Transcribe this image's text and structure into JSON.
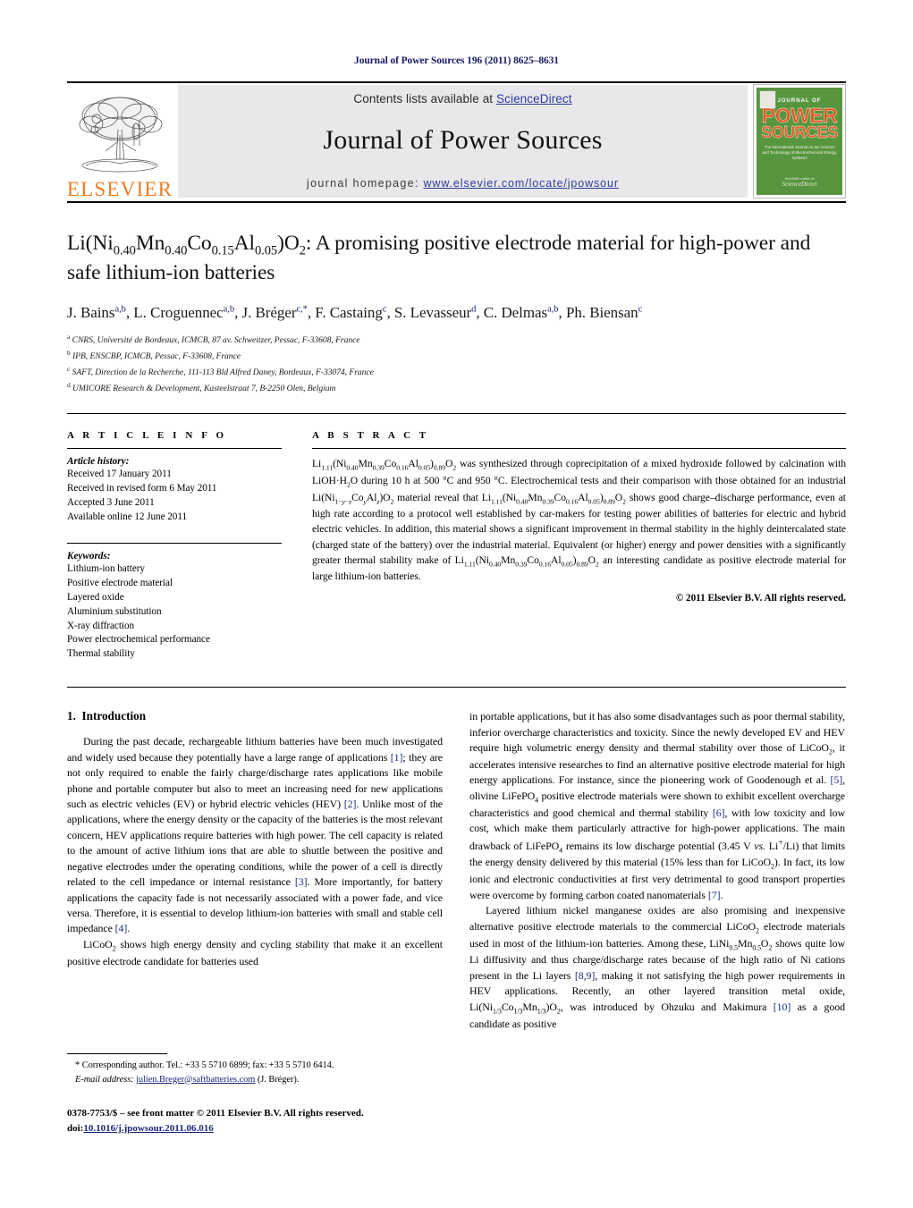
{
  "running_head": "Journal of Power Sources 196 (2011) 8625–8631",
  "masthead": {
    "publisher_name": "ELSEVIER",
    "contents_prefix": "Contents lists available at ",
    "sciencedirect": "ScienceDirect",
    "journal_title": "Journal of Power Sources",
    "homepage_prefix": "journal homepage: ",
    "homepage_url": "www.elsevier.com/locate/jpowsour",
    "cover": {
      "line1": "JOURNAL OF",
      "line2": "POWER",
      "line3": "SOURCES",
      "subtitle": "The International Journal on the Science and Technology of Electrochemical Energy Systems",
      "foot_small": "Available online at",
      "foot_big": "ScienceDirect"
    },
    "colors": {
      "link": "#2c3b9e",
      "elsevier_orange": "#ef7d22",
      "cover_green": "#57953f",
      "cover_orange": "#e2561f",
      "band_gray": "#e8e8ea"
    }
  },
  "title": {
    "part1": "Li(Ni",
    "sub1": "0.40",
    "part2": "Mn",
    "sub2": "0.40",
    "part3": "Co",
    "sub3": "0.15",
    "part4": "Al",
    "sub4": "0.05",
    "part5": ")O",
    "sub5": "2",
    "part6": ": A promising positive electrode material for high-power and safe lithium-ion batteries",
    "full": "Li(Ni0.40Mn0.40Co0.15Al0.05)O2: A promising positive electrode material for high-power and safe lithium-ion batteries"
  },
  "authors": [
    {
      "name": "J. Bains",
      "sup": "a,b"
    },
    {
      "name": "L. Croguennec",
      "sup": "a,b"
    },
    {
      "name": "J. Bréger",
      "sup": "c,*"
    },
    {
      "name": "F. Castaing",
      "sup": "c"
    },
    {
      "name": "S. Levasseur",
      "sup": "d"
    },
    {
      "name": "C. Delmas",
      "sup": "a,b"
    },
    {
      "name": "Ph. Biensan",
      "sup": "c"
    }
  ],
  "affiliations": [
    {
      "mark": "a",
      "text": "CNRS, Université de Bordeaux, ICMCB, 87 av. Schweitzer, Pessac, F-33608, France"
    },
    {
      "mark": "b",
      "text": "IPB, ENSCBP, ICMCB, Pessac, F-33608, France"
    },
    {
      "mark": "c",
      "text": "SAFT, Direction de la Recherche, 111-113 Bld Alfred Daney, Bordeaux, F-33074, France"
    },
    {
      "mark": "d",
      "text": "UMICORE Research & Development, Kasteelstraat 7, B-2250 Olen, Belgium"
    }
  ],
  "article_info": {
    "heading": "A R T I C L E    I N F O",
    "history_label": "Article history:",
    "history": [
      "Received 17 January 2011",
      "Received in revised form 6 May 2011",
      "Accepted 3 June 2011",
      "Available online 12 June 2011"
    ],
    "keywords_label": "Keywords:",
    "keywords": [
      "Lithium-ion battery",
      "Positive electrode material",
      "Layered oxide",
      "Aluminium substitution",
      "X-ray diffraction",
      "Power electrochemical performance",
      "Thermal stability"
    ]
  },
  "abstract": {
    "heading": "A B S T R A C T",
    "text": "was synthesized through coprecipitation of a mixed hydroxide followed by calcination with LiOH·H2O during 10 h at 500 °C and 950 °C. Electrochemical tests and their comparison with those obtained for an industrial Li(Ni1−y−zCoyAlz)O2 material reveal that Li1.11(Ni0.40Mn0.39Co0.16Al0.05)0.89O2 shows good charge–discharge performance, even at high rate according to a protocol well established by car-makers for testing power abilities of batteries for electric and hybrid electric vehicles. In addition, this material shows a significant improvement in thermal stability in the highly deintercalated state (charged state of the battery) over the industrial material. Equivalent (or higher) energy and power densities with a significantly greater thermal stability make of Li1.11(Ni0.40Mn0.39Co0.16Al0.05)0.89O2 an interesting candidate as positive electrode material for large lithium-ion batteries.",
    "copyright": "© 2011 Elsevier B.V. All rights reserved."
  },
  "introduction": {
    "section_number": "1.",
    "section_title": "Introduction"
  },
  "footnote": {
    "corresponding": "* Corresponding author. Tel.: +33 5 5710 6899; fax: +33 5 5710 6414.",
    "email_label": "E-mail address:",
    "email": "julien.Breger@saftbatteries.com",
    "email_owner": "(J. Bréger).",
    "issn_line": "0378-7753/$ – see front matter © 2011 Elsevier B.V. All rights reserved.",
    "doi_prefix": "doi:",
    "doi": "10.1016/j.jpowsour.2011.06.016"
  }
}
